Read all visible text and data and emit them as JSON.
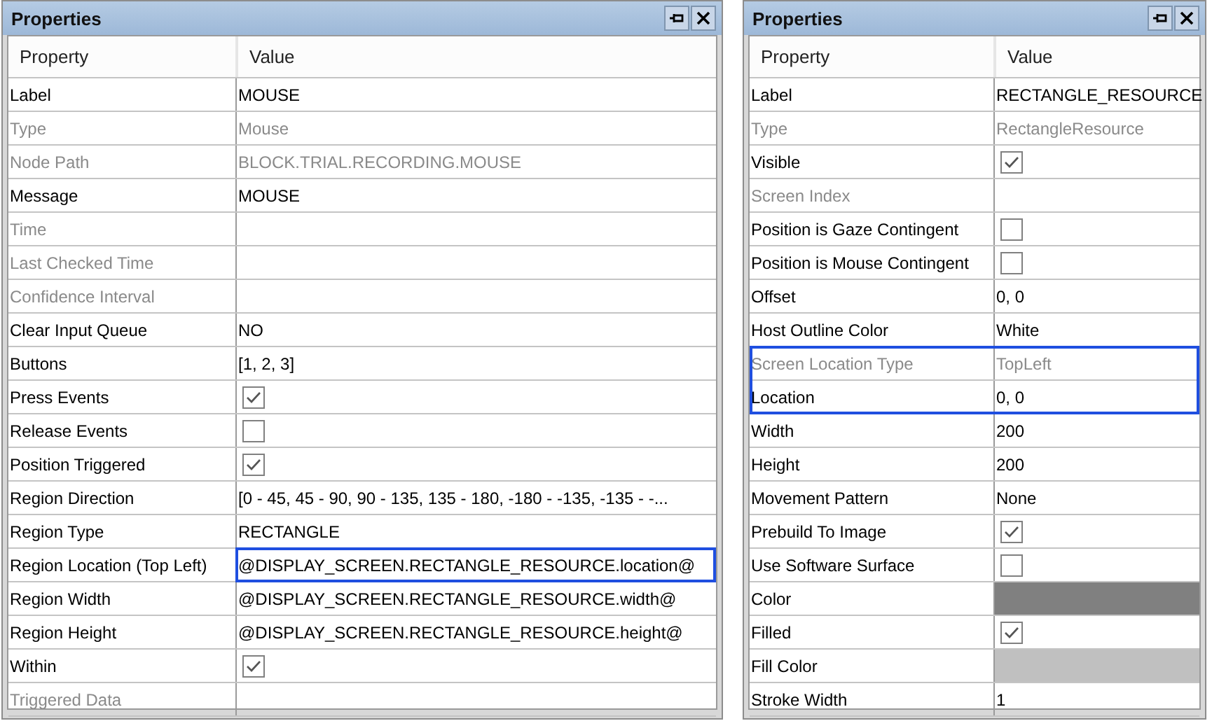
{
  "panels": [
    {
      "title": "Properties",
      "columns": [
        "Property",
        "Value"
      ],
      "rows": [
        {
          "name": "Label",
          "kind": "text",
          "value": "MOUSE",
          "readonly": false
        },
        {
          "name": "Type",
          "kind": "text",
          "value": "Mouse",
          "readonly": true
        },
        {
          "name": "Node Path",
          "kind": "text",
          "value": "BLOCK.TRIAL.RECORDING.MOUSE",
          "readonly": true
        },
        {
          "name": "Message",
          "kind": "text",
          "value": "MOUSE",
          "readonly": false
        },
        {
          "name": "Time",
          "kind": "text",
          "readonly": true
        },
        {
          "name": "Last Checked Time",
          "kind": "text",
          "readonly": true
        },
        {
          "name": "Confidence Interval",
          "kind": "text",
          "readonly": true
        },
        {
          "name": "Clear Input Queue",
          "kind": "text",
          "value": "NO",
          "readonly": false
        },
        {
          "name": "Buttons",
          "kind": "text",
          "value": "[1, 2, 3]",
          "readonly": false
        },
        {
          "name": "Press Events",
          "kind": "check",
          "checked": true,
          "readonly": false
        },
        {
          "name": "Release Events",
          "kind": "check",
          "checked": false,
          "readonly": false
        },
        {
          "name": "Position Triggered",
          "kind": "check",
          "checked": true,
          "readonly": false
        },
        {
          "name": "Region Direction",
          "kind": "text",
          "value": "[0 - 45, 45 - 90, 90 - 135, 135 - 180, -180 - -135, -135 - -...",
          "readonly": false
        },
        {
          "name": "Region Type",
          "kind": "text",
          "value": "RECTANGLE",
          "readonly": false
        },
        {
          "name": "Region Location (Top Left)",
          "kind": "text",
          "value": "@DISPLAY_SCREEN.RECTANGLE_RESOURCE.location@",
          "readonly": false,
          "value_outlined": true
        },
        {
          "name": "Region Width",
          "kind": "text",
          "value": "@DISPLAY_SCREEN.RECTANGLE_RESOURCE.width@",
          "readonly": false
        },
        {
          "name": "Region Height",
          "kind": "text",
          "value": "@DISPLAY_SCREEN.RECTANGLE_RESOURCE.height@",
          "readonly": false
        },
        {
          "name": "Within",
          "kind": "check",
          "checked": true,
          "readonly": false
        },
        {
          "name": "Triggered Data",
          "kind": "text",
          "readonly": true
        }
      ]
    },
    {
      "title": "Properties",
      "columns": [
        "Property",
        "Value"
      ],
      "rows": [
        {
          "name": "Label",
          "kind": "text",
          "value": "RECTANGLE_RESOURCE",
          "readonly": false
        },
        {
          "name": "Type",
          "kind": "text",
          "value": "RectangleResource",
          "readonly": true
        },
        {
          "name": "Visible",
          "kind": "check",
          "checked": true,
          "readonly": false
        },
        {
          "name": "Screen Index",
          "kind": "text",
          "readonly": true
        },
        {
          "name": "Position is Gaze Contingent",
          "kind": "check",
          "checked": false,
          "readonly": false
        },
        {
          "name": "Position is Mouse Contingent",
          "kind": "check",
          "checked": false,
          "readonly": false
        },
        {
          "name": "Offset",
          "kind": "text",
          "value": "0, 0",
          "readonly": false
        },
        {
          "name": "Host Outline Color",
          "kind": "text",
          "value": "White",
          "readonly": false
        },
        {
          "name": "Screen Location Type",
          "kind": "text",
          "value": "TopLeft",
          "readonly": true,
          "outlined": true
        },
        {
          "name": "Location",
          "kind": "text",
          "value": "0, 0",
          "readonly": false,
          "outlined": true
        },
        {
          "name": "Width",
          "kind": "text",
          "value": "200",
          "readonly": false
        },
        {
          "name": "Height",
          "kind": "text",
          "value": "200",
          "readonly": false
        },
        {
          "name": "Movement Pattern",
          "kind": "text",
          "value": "None",
          "readonly": false
        },
        {
          "name": "Prebuild To Image",
          "kind": "check",
          "checked": true,
          "readonly": false
        },
        {
          "name": "Use Software Surface",
          "kind": "check",
          "checked": false,
          "readonly": false
        },
        {
          "name": "Color",
          "kind": "color",
          "color": "#808080",
          "readonly": false
        },
        {
          "name": "Filled",
          "kind": "check",
          "checked": true,
          "readonly": false
        },
        {
          "name": "Fill Color",
          "kind": "color",
          "color": "#c0c0c0",
          "readonly": false
        },
        {
          "name": "Stroke Width",
          "kind": "text",
          "value": "1",
          "readonly": false
        }
      ]
    }
  ]
}
